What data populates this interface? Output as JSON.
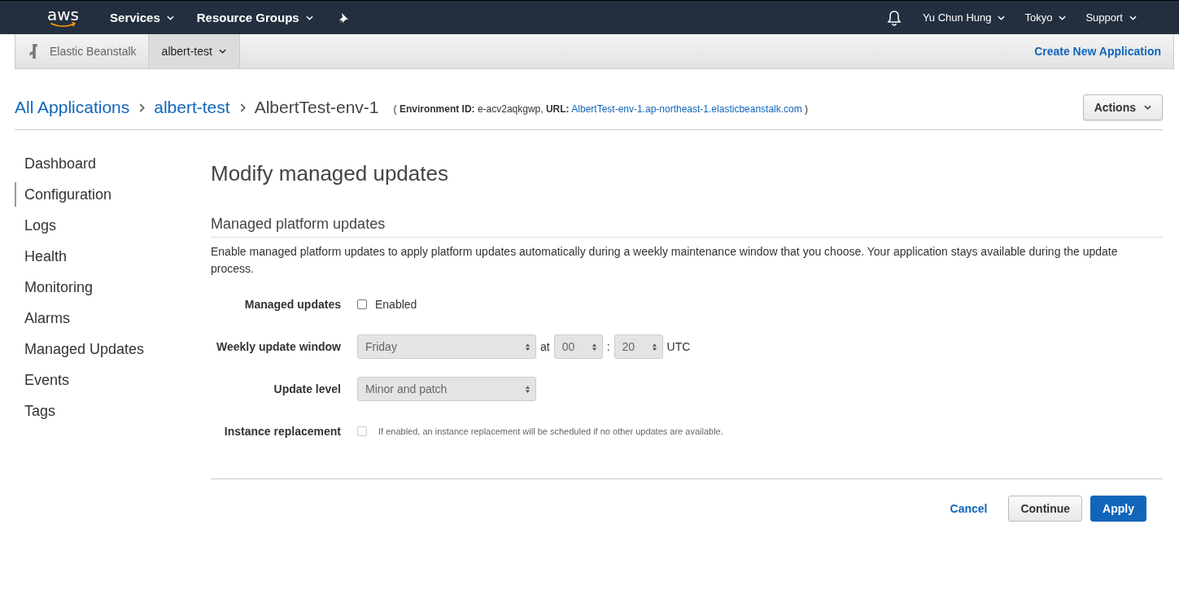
{
  "top_nav": {
    "logo": "aws",
    "menus": [
      {
        "label": "Services"
      },
      {
        "label": "Resource Groups"
      }
    ],
    "right_menus": [
      {
        "label": "Yu Chun Hung"
      },
      {
        "label": "Tokyo"
      },
      {
        "label": "Support"
      }
    ]
  },
  "sub_nav": {
    "service": "Elastic Beanstalk",
    "app_menu": "albert-test",
    "create_link": "Create New Application"
  },
  "breadcrumb": {
    "items": [
      {
        "label": "All Applications",
        "link": true
      },
      {
        "label": "albert-test",
        "link": true
      },
      {
        "label": "AlbertTest-env-1",
        "link": false
      }
    ],
    "env_info": "( **Environment ID:** e-acv2aqkgwp, **URL:**",
    "env_url": "AlbertTest-env-1.ap-northeast-1.elasticbeanstalk.com",
    "env_info_end": ")",
    "actions": "Actions"
  },
  "sidebar": {
    "items": [
      {
        "label": "Dashboard",
        "selected": false
      },
      {
        "label": "Configuration",
        "selected": true
      },
      {
        "label": "Logs",
        "selected": false
      },
      {
        "label": "Health",
        "selected": false
      },
      {
        "label": "Monitoring",
        "selected": false
      },
      {
        "label": "Alarms",
        "selected": false
      },
      {
        "label": "Managed Updates",
        "selected": false
      },
      {
        "label": "Events",
        "selected": false
      },
      {
        "label": "Tags",
        "selected": false
      }
    ]
  },
  "page_title": "Modify managed updates",
  "section": {
    "title": "Managed platform updates",
    "description": "Enable managed platform updates to apply platform updates automatically during a weekly maintenance window that you choose. Your application stays available during the update process."
  },
  "form": [
    {
      "kind": "checkbox",
      "label": "Managed updates",
      "checked": false,
      "disabled": false,
      "text": "Enabled"
    },
    {
      "kind": "schedule",
      "label": "Weekly update window",
      "day": "Friday",
      "at": "at",
      "hour": "00",
      "sep": ":",
      "minute": "20",
      "zone": "UTC",
      "disabled": true
    },
    {
      "kind": "select",
      "label": "Update level",
      "value": "Minor and patch",
      "disabled": true
    },
    {
      "kind": "checkbox",
      "label": "Instance replacement",
      "checked": false,
      "disabled": true,
      "text": "If enabled, an instance replacement will be scheduled if no other updates are available."
    }
  ],
  "buttons": [
    {
      "kind": "link",
      "label": "Cancel"
    },
    {
      "kind": "default",
      "label": "Continue"
    },
    {
      "kind": "primary",
      "label": "Apply"
    }
  ]
}
